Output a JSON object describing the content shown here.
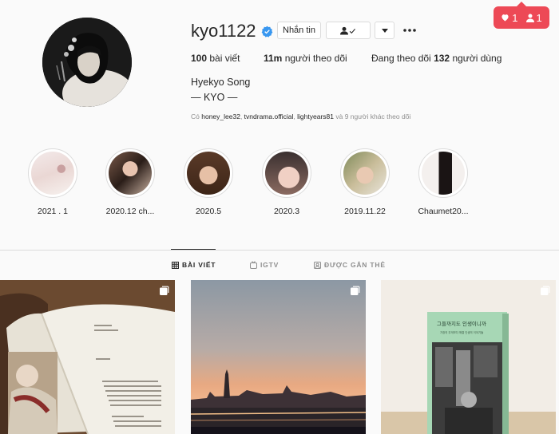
{
  "notification": {
    "likes": "1",
    "follows": "1",
    "like_icon": "heart-icon",
    "follow_icon": "person-icon"
  },
  "profile": {
    "username": "kyo1122",
    "verified": true,
    "message_button": "Nhắn tin",
    "stats": {
      "posts_count": "100",
      "posts_label": "bài viết",
      "followers_count": "11m",
      "followers_label": "người theo dõi",
      "following_prefix": "Đang theo dõi",
      "following_count": "132",
      "following_suffix": "người dùng"
    },
    "full_name": "Hyekyo Song",
    "bio": "— KYO —",
    "followed_by": {
      "prefix": "Có",
      "users": [
        "honey_lee32",
        "tvndrama.official",
        "lightyears81"
      ],
      "suffix": "và 9 người khác theo dõi"
    }
  },
  "highlights": [
    {
      "label": "2021 . 1"
    },
    {
      "label": "2020.12 ch..."
    },
    {
      "label": "2020.5"
    },
    {
      "label": "2020.3"
    },
    {
      "label": "2019.11.22"
    },
    {
      "label": "Chaumet20..."
    }
  ],
  "tabs": [
    {
      "label": "BÀI VIẾT",
      "icon": "grid-icon",
      "active": true
    },
    {
      "label": "IGTV",
      "icon": "igtv-icon",
      "active": false
    },
    {
      "label": "ĐƯỢC GẮN THẺ",
      "icon": "tag-icon",
      "active": false
    }
  ],
  "posts": [
    {
      "type": "carousel",
      "subject": "open book"
    },
    {
      "type": "carousel",
      "subject": "city skyline at sunset"
    },
    {
      "type": "carousel",
      "subject": "book cover"
    }
  ],
  "post3_book_title": "그들까지도 인생이니까",
  "post3_book_subtitle": "가장의 무게보다 해결 인생의 이야기들"
}
